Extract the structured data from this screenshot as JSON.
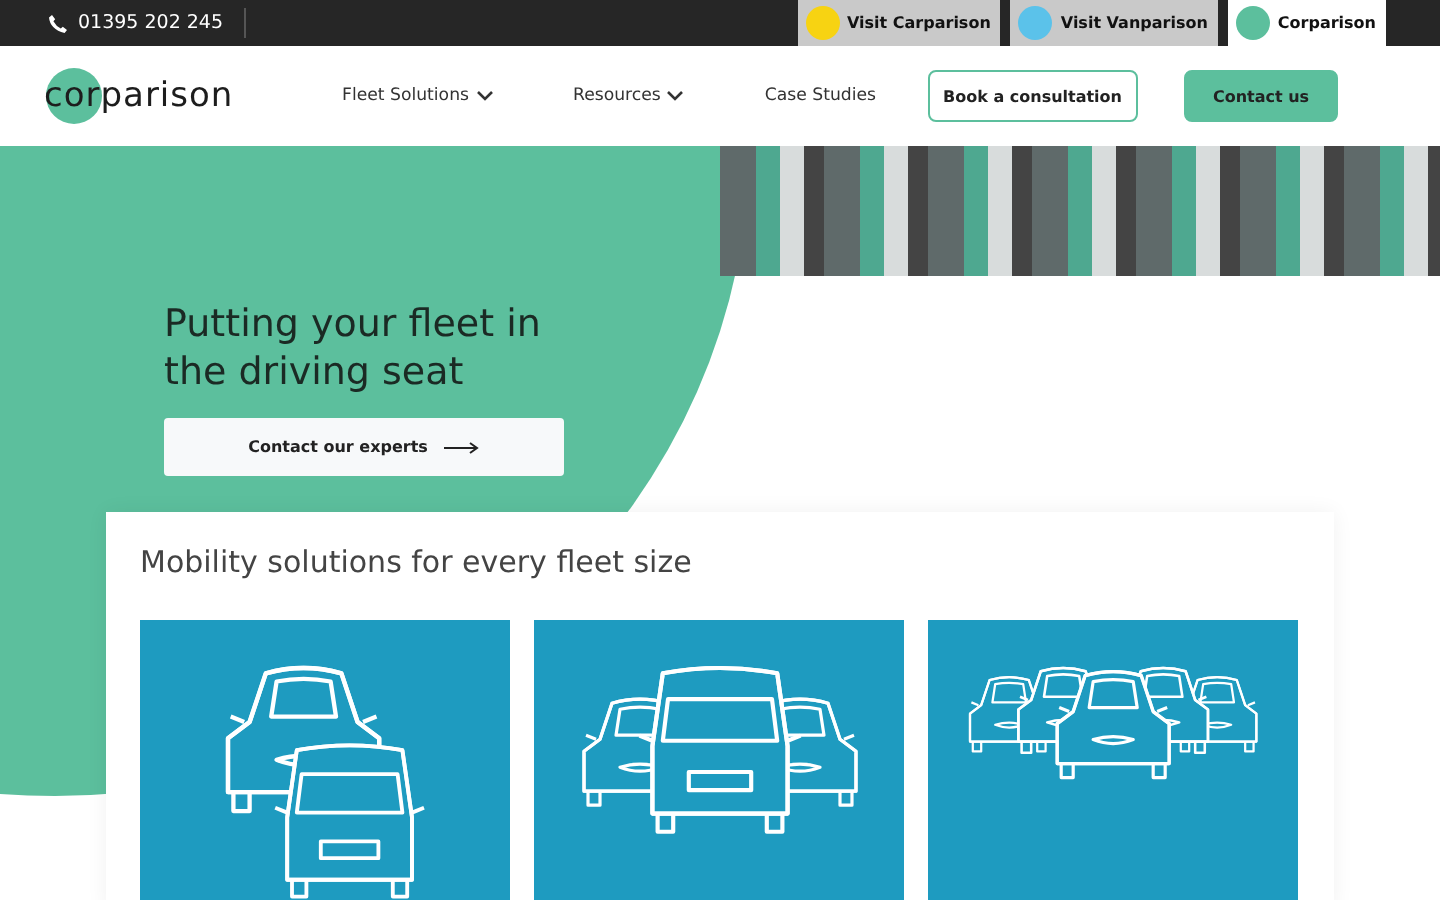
{
  "top_bar": {
    "phone": "01395 202 245",
    "sites": [
      {
        "label": "Visit Carparison",
        "color": "#f7d312",
        "selected": false
      },
      {
        "label": "Visit Vanparison",
        "color": "#5bc2ea",
        "selected": false
      },
      {
        "label": "Corparison",
        "color": "#5cbf9d",
        "selected": true
      }
    ]
  },
  "header": {
    "logo": "corparison",
    "nav": [
      {
        "label": "Fleet Solutions",
        "dropdown": true
      },
      {
        "label": "Resources",
        "dropdown": true
      },
      {
        "label": "Case Studies",
        "dropdown": false
      }
    ],
    "buttons": [
      {
        "label": "Book a consultation",
        "kind": "outline"
      },
      {
        "label": "Contact us",
        "kind": "filled"
      }
    ]
  },
  "hero": {
    "heading": "Putting your fleet in the driving seat",
    "button": "Contact our experts"
  },
  "solutions": {
    "title": "Mobility solutions for every fleet size",
    "tiles": [
      {
        "kind": "car-van"
      },
      {
        "kind": "van-cars"
      },
      {
        "kind": "many-cars"
      }
    ]
  }
}
